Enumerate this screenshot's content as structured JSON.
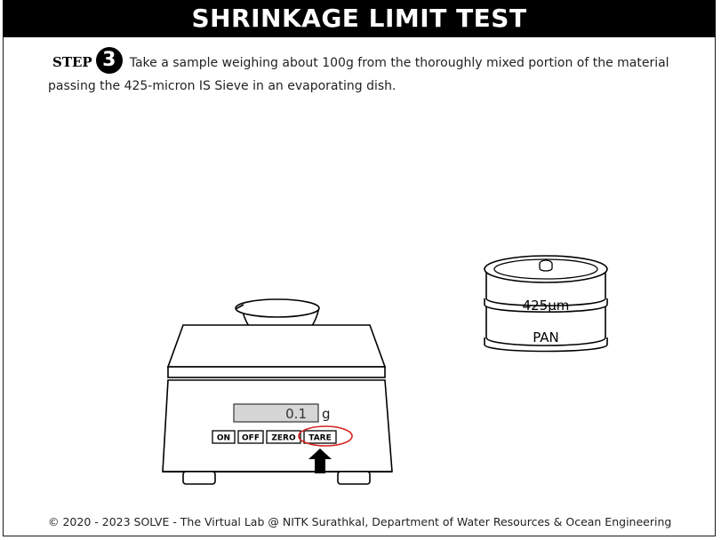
{
  "header": {
    "title": "SHRINKAGE LIMIT TEST"
  },
  "step": {
    "label": "STEP",
    "number": "3",
    "instruction": "Take a sample weighing about 100g from the thoroughly mixed portion of the material passing the 425-micron IS Sieve in an evaporating dish."
  },
  "balance": {
    "display_value": "0.1",
    "unit": "g",
    "buttons": {
      "on": "ON",
      "off": "OFF",
      "zero": "ZERO",
      "tare": "TARE"
    },
    "highlighted_button": "TARE",
    "highlight_color": "#d42020"
  },
  "sieve": {
    "top_label": "425µm",
    "pan_label": "PAN"
  },
  "footer": {
    "text": "© 2020 - 2023 SOLVE - The Virtual Lab @ NITK Surathkal, Department of Water Resources & Ocean Engineering"
  }
}
